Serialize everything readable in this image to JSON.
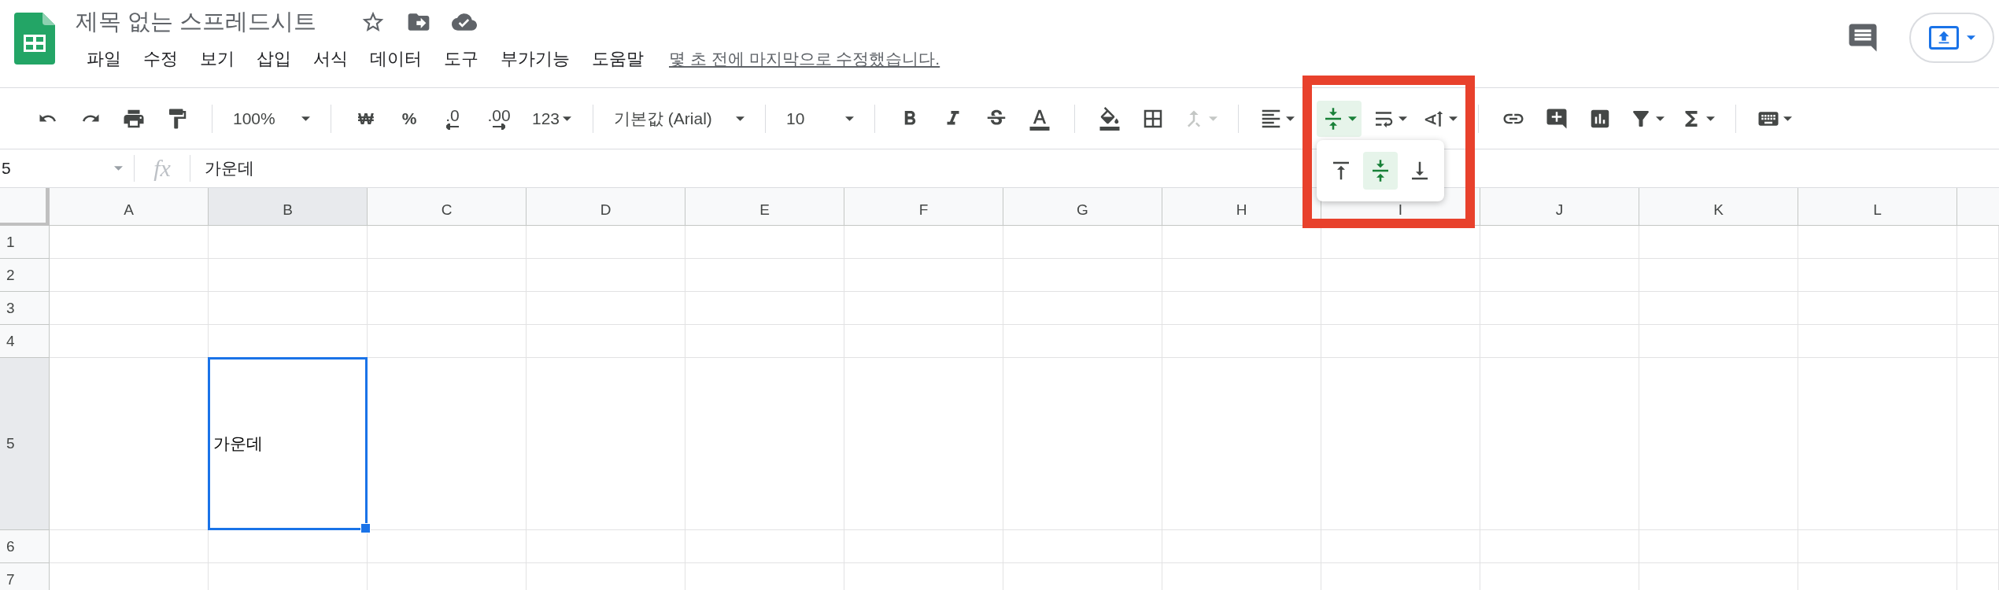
{
  "document": {
    "title": "제목 없는 스프레드시트",
    "last_edit": "몇 초 전에 마지막으로 수정했습니다."
  },
  "menu": [
    "파일",
    "수정",
    "보기",
    "삽입",
    "서식",
    "데이터",
    "도구",
    "부가기능",
    "도움말"
  ],
  "toolbar": {
    "zoom": "100%",
    "currency": "₩",
    "percent": "%",
    "decimal_decrease": ".0",
    "decimal_increase": ".00",
    "number_format": "123",
    "font": "기본값 (Arial)",
    "font_size": "10",
    "merge": {
      "disabled": true
    },
    "vertical_align": {
      "expanded": true,
      "options": [
        {
          "kind": "top",
          "selected": false
        },
        {
          "kind": "middle",
          "selected": true
        },
        {
          "kind": "bottom",
          "selected": false
        }
      ]
    }
  },
  "formula_bar": {
    "name_box": "5",
    "fx": "fx",
    "value": "가운데"
  },
  "sheet": {
    "columns": [
      {
        "label": "A",
        "selected": false
      },
      {
        "label": "B",
        "selected": true
      },
      {
        "label": "C",
        "selected": false
      },
      {
        "label": "D",
        "selected": false
      },
      {
        "label": "E",
        "selected": false
      },
      {
        "label": "F",
        "selected": false
      },
      {
        "label": "G",
        "selected": false
      },
      {
        "label": "H",
        "selected": false
      },
      {
        "label": "I",
        "selected": false
      },
      {
        "label": "J",
        "selected": false
      },
      {
        "label": "K",
        "selected": false
      },
      {
        "label": "L",
        "selected": false
      }
    ],
    "rows": [
      {
        "label": "1",
        "selected": false,
        "tall": false
      },
      {
        "label": "2",
        "selected": false,
        "tall": false
      },
      {
        "label": "3",
        "selected": false,
        "tall": false
      },
      {
        "label": "4",
        "selected": false,
        "tall": false
      },
      {
        "label": "5",
        "selected": true,
        "tall": true
      },
      {
        "label": "6",
        "selected": false,
        "tall": false
      },
      {
        "label": "7",
        "selected": false,
        "tall": false
      }
    ],
    "active_cell": {
      "value": "가운데"
    }
  }
}
